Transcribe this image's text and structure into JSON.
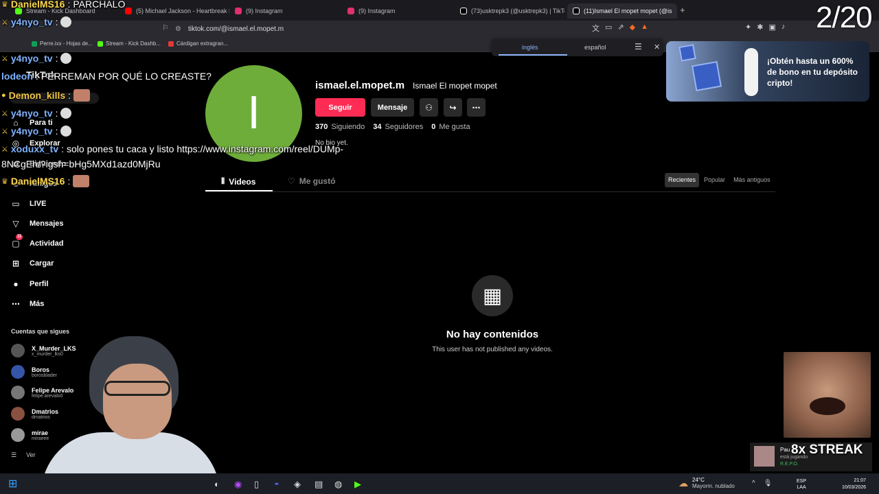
{
  "browser": {
    "tabs": [
      {
        "label": "Stream - Kick Dashboard",
        "color": "#53fc18"
      },
      {
        "label": "(5) Michael Jackson - Heartbreak Hot",
        "color": "#ff0000"
      },
      {
        "label": "(9) Instagram",
        "color": "#e1306c"
      },
      {
        "label": "(9) Instagram",
        "color": "#e1306c"
      },
      {
        "label": "(73)usktrepk3 (@usktrepk3) | TikTok",
        "color": "#ffffff"
      },
      {
        "label": "(11)Ismael El mopet mopet (@is",
        "color": "#ffffff"
      }
    ],
    "url": "tiktok.com/@ismael.el.mopet.m",
    "bookmarks": [
      "Perre.ixx - Hojas de...",
      "Stream - Kick Dashb...",
      "Cárdigan extragran..."
    ]
  },
  "translate": {
    "lang_a": "inglés",
    "lang_b": "español"
  },
  "sidebar": {
    "logo": "TikTok",
    "search_placeholder": "Buscar",
    "nav": [
      {
        "label": "Para ti",
        "icon": "home-icon"
      },
      {
        "label": "Explorar",
        "icon": "compass-icon"
      },
      {
        "label": "Siguiendo",
        "icon": "following-icon"
      },
      {
        "label": "Amigos",
        "icon": "friends-icon"
      },
      {
        "label": "LIVE",
        "icon": "live-icon"
      },
      {
        "label": "Mensajes",
        "icon": "messages-icon"
      },
      {
        "label": "Actividad",
        "icon": "activity-icon",
        "badge": "11"
      },
      {
        "label": "Cargar",
        "icon": "upload-icon"
      },
      {
        "label": "Perfil",
        "icon": "profile-icon"
      },
      {
        "label": "Más",
        "icon": "more-icon"
      }
    ],
    "following_title": "Cuentas que sigues",
    "accounts": [
      {
        "name": "X_Murder_LKS",
        "handle": "x_murder_lks0"
      },
      {
        "name": "Boros",
        "handle": "borosblader"
      },
      {
        "name": "Felipe Arevalo",
        "handle": "felipe.arevalo0"
      },
      {
        "name": "Dmatrios",
        "handle": "dmatrios"
      },
      {
        "name": "mirae",
        "handle": "miraeee"
      }
    ],
    "see_more": "Ver"
  },
  "profile": {
    "avatar_letter": "I",
    "avatar_color": "#6ead3a",
    "username": "ismael.el.mopet.m",
    "display_name": "Ismael El mopet mopet",
    "follow_label": "Seguir",
    "message_label": "Mensaje",
    "following_count": "370",
    "following_label": "Siguiendo",
    "followers_count": "34",
    "followers_label": "Seguidores",
    "likes_count": "0",
    "likes_label": "Me gusta",
    "bio": "No bio yet."
  },
  "content_tabs": {
    "videos": "Videos",
    "liked": "Me gustó",
    "sort": [
      "Recientes",
      "Popular",
      "Más antiguos"
    ]
  },
  "empty": {
    "title": "No hay contenidos",
    "subtitle": "This user has not published any videos."
  },
  "ad": {
    "text": "¡Obtén hasta un 600% de bono en tu depósito cripto!"
  },
  "stream": {
    "counter": "2/20",
    "chat": [
      {
        "user": "DanielMS16",
        "msg": "PARCHALO"
      },
      {
        "user": "y4nyo_tv",
        "msg": ""
      },
      {
        "user": "y4nyo_tv",
        "msg": ""
      },
      {
        "user": "lodeon",
        "msg": "PERREMAN POR QUÉ LO CREASTE?"
      },
      {
        "user": "Demon_kills",
        "msg": ""
      },
      {
        "user": "y4nyo_tv",
        "msg": ""
      },
      {
        "user": "y4nyo_tv",
        "msg": ""
      },
      {
        "user": "xoduxx_tv",
        "msg": "solo pones tu caca y listo https://www.instagram.com/reel/DUMp-"
      },
      {
        "user": "",
        "msg": "8NCgEh/?igsh=bHg5MXd1azd0MjRu"
      },
      {
        "user": "DanielMS16",
        "msg": ""
      }
    ],
    "streak_name": "Pau",
    "streak_status": "está jugando",
    "streak_game": "R.E.P.O.",
    "streak_label": "8x STREAK"
  },
  "taskbar": {
    "temp": "24°C",
    "weather": "Mayorm. nublado",
    "lang1": "ESP",
    "lang2": "LAA",
    "time": "21:07",
    "date": "10/03/2026"
  }
}
